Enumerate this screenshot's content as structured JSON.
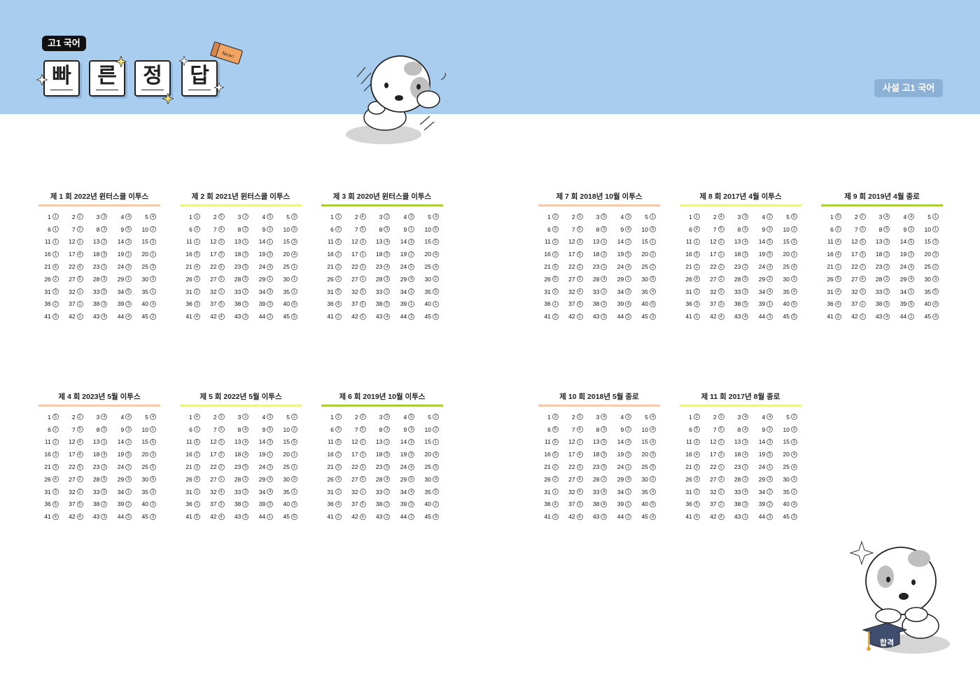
{
  "header": {
    "subject": "고1 국어",
    "title_chars": [
      "빠",
      "른",
      "정",
      "답"
    ],
    "book_label": "New!",
    "brand": "사설 고1 국어",
    "mascot_badge": "합격"
  },
  "colors": {
    "header_bg": "#a9cdef",
    "rule_colors": [
      "#f4c9ad",
      "#eef28b",
      "#a8cf3a"
    ]
  },
  "exams": [
    {
      "title": "제 1 회  2022년 윈터스쿨 이투스",
      "rule": "#f4c9ad",
      "answers": [
        1,
        2,
        3,
        4,
        4,
        1,
        2,
        3,
        5,
        2,
        1,
        1,
        2,
        3,
        3,
        1,
        4,
        3,
        1,
        1,
        4,
        4,
        1,
        3,
        3,
        2,
        5,
        3,
        1,
        3,
        3,
        1,
        5,
        5,
        1,
        2,
        1,
        3,
        3,
        4,
        3,
        1,
        4,
        4,
        2
      ]
    },
    {
      "title": "제 2 회  2021년 윈터스쿨 이투스",
      "rule": "#eef28b",
      "answers": [
        1,
        5,
        2,
        5,
        3,
        3,
        4,
        2,
        2,
        3,
        1,
        3,
        1,
        1,
        3,
        5,
        3,
        3,
        3,
        4,
        4,
        5,
        5,
        4,
        1,
        3,
        3,
        5,
        1,
        1,
        2,
        1,
        2,
        3,
        1,
        3,
        5,
        3,
        3,
        5,
        4,
        4,
        3,
        2,
        5
      ]
    },
    {
      "title": "제 3 회  2020년 윈터스쿨 이투스",
      "rule": "#a8cf3a",
      "answers": [
        1,
        4,
        2,
        3,
        4,
        2,
        5,
        3,
        1,
        5,
        5,
        3,
        4,
        3,
        5,
        2,
        1,
        5,
        2,
        4,
        2,
        3,
        4,
        5,
        4,
        2,
        1,
        3,
        4,
        2,
        5,
        5,
        1,
        2,
        5,
        4,
        5,
        5,
        1,
        1,
        2,
        5,
        4,
        3,
        5
      ]
    },
    {
      "title": "제 4 회  2023년 5월 이투스",
      "rule": "#f4c9ad",
      "answers": [
        5,
        2,
        4,
        4,
        4,
        2,
        5,
        5,
        3,
        1,
        2,
        4,
        1,
        2,
        5,
        3,
        4,
        4,
        5,
        3,
        3,
        5,
        2,
        2,
        5,
        4,
        2,
        5,
        3,
        5,
        3,
        2,
        5,
        1,
        3,
        5,
        5,
        2,
        2,
        3,
        4,
        4,
        3,
        5,
        3
      ]
    },
    {
      "title": "제 5 회  2022년 5월 이투스",
      "rule": "#eef28b",
      "answers": [
        4,
        3,
        1,
        3,
        2,
        1,
        3,
        4,
        5,
        2,
        5,
        3,
        4,
        3,
        5,
        2,
        3,
        4,
        1,
        1,
        3,
        2,
        5,
        3,
        1,
        4,
        1,
        2,
        4,
        3,
        1,
        4,
        3,
        4,
        1,
        1,
        3,
        2,
        3,
        3,
        5,
        4,
        5,
        1,
        5
      ]
    },
    {
      "title": "제 6 회  2019년 10월 이투스",
      "rule": "#a8cf3a",
      "answers": [
        2,
        3,
        5,
        5,
        2,
        3,
        5,
        3,
        3,
        2,
        5,
        2,
        1,
        3,
        1,
        2,
        3,
        5,
        3,
        4,
        3,
        3,
        5,
        4,
        5,
        3,
        5,
        4,
        5,
        4,
        2,
        1,
        2,
        4,
        5,
        4,
        5,
        2,
        3,
        2,
        2,
        4,
        2,
        2,
        4
      ]
    },
    {
      "title": "제 7 회  2018년 10월 이투스",
      "rule": "#f4c9ad",
      "answers": [
        2,
        3,
        5,
        3,
        1,
        3,
        5,
        5,
        4,
        5,
        3,
        3,
        1,
        2,
        1,
        3,
        5,
        2,
        5,
        2,
        5,
        2,
        1,
        4,
        2,
        5,
        3,
        4,
        1,
        5,
        3,
        4,
        1,
        3,
        4,
        1,
        5,
        2,
        4,
        5,
        3,
        2,
        3,
        5,
        3
      ]
    },
    {
      "title": "제 8 회  2017년 4월 이투스",
      "rule": "#eef28b",
      "answers": [
        1,
        4,
        3,
        2,
        5,
        4,
        5,
        5,
        2,
        2,
        1,
        2,
        4,
        5,
        3,
        5,
        1,
        3,
        5,
        1,
        2,
        2,
        2,
        4,
        4,
        4,
        2,
        5,
        2,
        3,
        2,
        3,
        3,
        4,
        4,
        3,
        3,
        5,
        1,
        5,
        1,
        4,
        4,
        3,
        5
      ]
    },
    {
      "title": "제 9 회  2019년 4월 종로",
      "rule": "#a8cf3a",
      "answers": [
        5,
        2,
        4,
        4,
        1,
        2,
        3,
        5,
        2,
        1,
        4,
        5,
        3,
        5,
        3,
        4,
        3,
        2,
        2,
        3,
        1,
        2,
        2,
        4,
        2,
        5,
        4,
        2,
        4,
        3,
        4,
        3,
        3,
        1,
        5,
        4,
        1,
        5,
        5,
        4,
        3,
        1,
        4,
        1,
        4
      ]
    },
    {
      "title": "제 10 회  2018년 5월 종로",
      "rule": "#f4c9ad",
      "answers": [
        3,
        3,
        4,
        3,
        4,
        5,
        4,
        3,
        2,
        4,
        5,
        1,
        5,
        4,
        4,
        5,
        4,
        3,
        3,
        3,
        2,
        3,
        5,
        1,
        5,
        2,
        4,
        2,
        4,
        2,
        1,
        4,
        4,
        1,
        4,
        4,
        3,
        4,
        1,
        5,
        3,
        4,
        3,
        2,
        4
      ]
    },
    {
      "title": "제 11 회  2017년 8월 종로",
      "rule": "#eef28b",
      "answers": [
        2,
        3,
        4,
        4,
        2,
        5,
        5,
        4,
        2,
        3,
        3,
        2,
        3,
        3,
        3,
        4,
        3,
        4,
        5,
        4,
        3,
        1,
        2,
        1,
        4,
        3,
        3,
        2,
        3,
        3,
        2,
        2,
        4,
        2,
        2,
        5,
        2,
        3,
        2,
        4,
        4,
        4,
        1,
        3,
        3
      ]
    }
  ]
}
